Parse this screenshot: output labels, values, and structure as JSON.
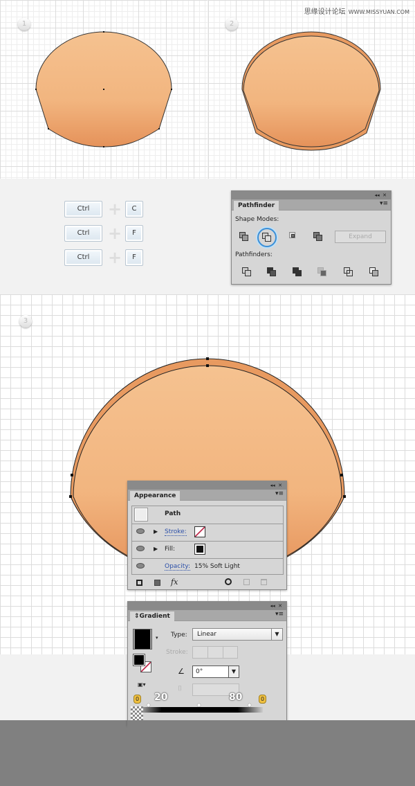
{
  "watermark": {
    "chinese": "思缘设计论坛",
    "url": "WWW.MISSYUAN.COM"
  },
  "steps": [
    "1",
    "2",
    "3"
  ],
  "colors": {
    "shape_light": "#f5c08e",
    "shape_dark": "#e89a60",
    "outline": "#333333",
    "panel_bg": "#d6d6d6",
    "highlight": "#3a8fd8"
  },
  "shortcuts": [
    {
      "mod": "Ctrl",
      "key": "C"
    },
    {
      "mod": "Ctrl",
      "key": "F"
    },
    {
      "mod": "Ctrl",
      "key": "F"
    }
  ],
  "pathfinder": {
    "tab": "Pathfinder",
    "shape_modes_label": "Shape Modes:",
    "pathfinders_label": "Pathfinders:",
    "expand": "Expand",
    "selected": "minus-front"
  },
  "appearance": {
    "tab": "Appearance",
    "object": "Path",
    "stroke_label": "Stroke:",
    "fill_label": "Fill:",
    "opacity_label": "Opacity:",
    "opacity_value": "15% Soft Light",
    "fx": "fx"
  },
  "gradient": {
    "tab": "Gradient",
    "type_label": "Type:",
    "type_value": "Linear",
    "stroke_label": "Stroke:",
    "angle_value": "0°",
    "stop_left_opacity": "0",
    "location_left": "20",
    "location_right": "80",
    "stop_right_opacity": "0"
  }
}
